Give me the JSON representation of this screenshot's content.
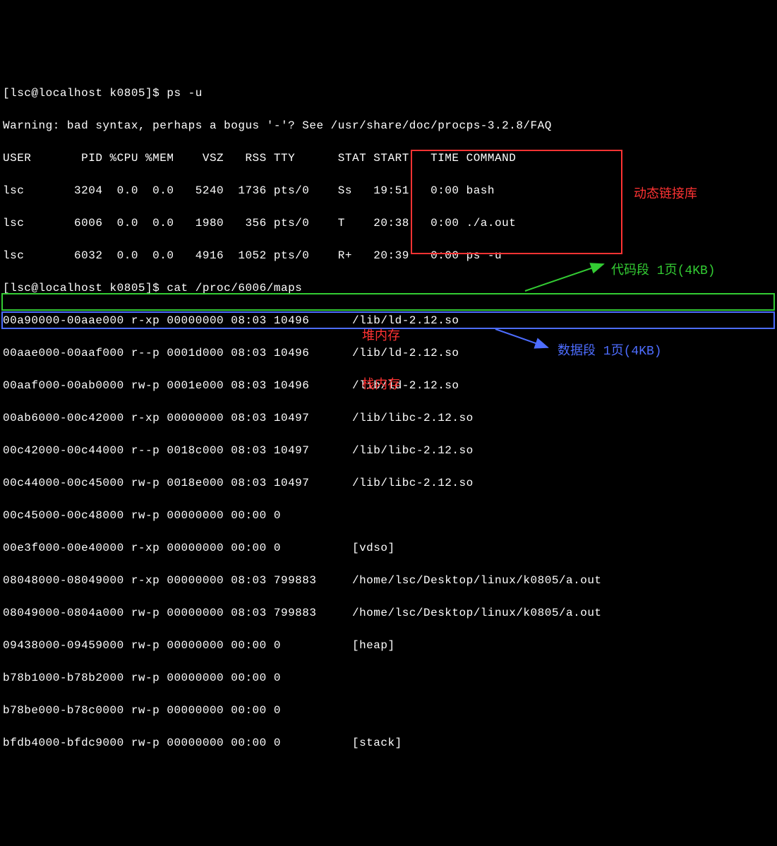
{
  "prompt1": "[lsc@localhost k0805]$ ps -u",
  "warning": "Warning: bad syntax, perhaps a bogus '-'? See /usr/share/doc/procps-3.2.8/FAQ",
  "ps_header": "USER       PID %CPU %MEM    VSZ   RSS TTY      STAT START   TIME COMMAND",
  "ps_rows": [
    "lsc       3204  0.0  0.0   5240  1736 pts/0    Ss   19:51   0:00 bash",
    "lsc       6006  0.0  0.0   1980   356 pts/0    T    20:38   0:00 ./a.out",
    "lsc       6032  0.0  0.0   4916  1052 pts/0    R+   20:39   0:00 ps -u"
  ],
  "prompt2": "[lsc@localhost k0805]$ cat /proc/6006/maps",
  "maps": [
    "00a90000-00aae000 r-xp 00000000 08:03 10496      /lib/ld-2.12.so",
    "00aae000-00aaf000 r--p 0001d000 08:03 10496      /lib/ld-2.12.so",
    "00aaf000-00ab0000 rw-p 0001e000 08:03 10496      /lib/ld-2.12.so",
    "00ab6000-00c42000 r-xp 00000000 08:03 10497      /lib/libc-2.12.so",
    "00c42000-00c44000 r--p 0018c000 08:03 10497      /lib/libc-2.12.so",
    "00c44000-00c45000 rw-p 0018e000 08:03 10497      /lib/libc-2.12.so",
    "00c45000-00c48000 rw-p 00000000 00:00 0 ",
    "00e3f000-00e40000 r-xp 00000000 00:00 0          [vdso]",
    "08048000-08049000 r-xp 00000000 08:03 799883     /home/lsc/Desktop/linux/k0805/a.out",
    "08049000-0804a000 rw-p 00000000 08:03 799883     /home/lsc/Desktop/linux/k0805/a.out",
    "09438000-09459000 rw-p 00000000 00:00 0          [heap]",
    "b78b1000-b78b2000 rw-p 00000000 00:00 0 ",
    "b78be000-b78c0000 rw-p 00000000 00:00 0 ",
    "bfdb4000-bfdc9000 rw-p 00000000 00:00 0          [stack]"
  ],
  "ann": {
    "dyn_lib": "动态链接库",
    "code_seg": "代码段 1页(4KB)",
    "data_seg": "数据段 1页(4KB)",
    "heap_mem": "堆内存",
    "stack_mem": "栈内存"
  }
}
